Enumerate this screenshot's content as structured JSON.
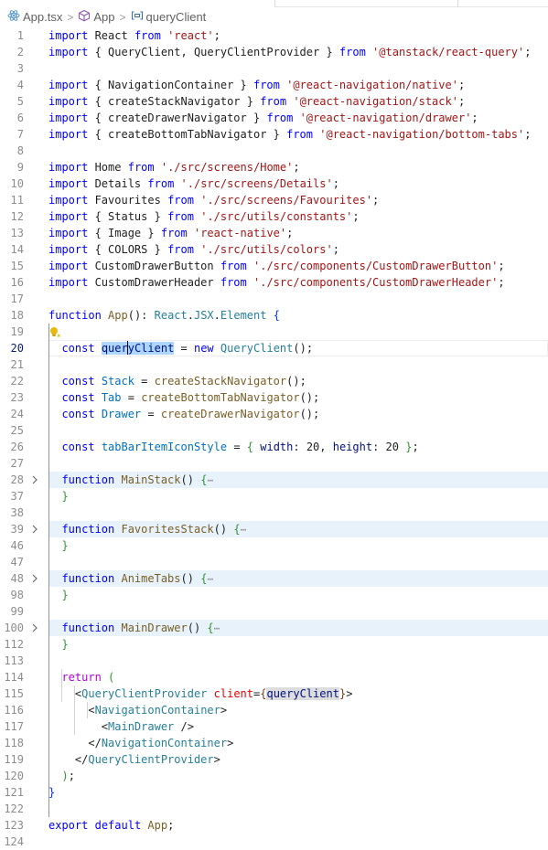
{
  "breadcrumb": {
    "file": "App.tsx",
    "symbol1": "App",
    "symbol2": "queryClient"
  },
  "lines": [
    {
      "n": "1",
      "tokens": [
        [
          "kw",
          "import"
        ],
        [
          "p",
          " React "
        ],
        [
          "kw",
          "from"
        ],
        [
          "p",
          " "
        ],
        [
          "str",
          "'react'"
        ],
        [
          "p",
          ";"
        ]
      ]
    },
    {
      "n": "2",
      "tokens": [
        [
          "kw",
          "import"
        ],
        [
          "p",
          " { QueryClient, QueryClientProvider } "
        ],
        [
          "kw",
          "from"
        ],
        [
          "p",
          " "
        ],
        [
          "str",
          "'@tanstack/react-query'"
        ],
        [
          "p",
          ";"
        ]
      ]
    },
    {
      "n": "3",
      "tokens": []
    },
    {
      "n": "4",
      "tokens": [
        [
          "kw",
          "import"
        ],
        [
          "p",
          " { NavigationContainer } "
        ],
        [
          "kw",
          "from"
        ],
        [
          "p",
          " "
        ],
        [
          "str",
          "'@react-navigation/native'"
        ],
        [
          "p",
          ";"
        ]
      ]
    },
    {
      "n": "5",
      "tokens": [
        [
          "kw",
          "import"
        ],
        [
          "p",
          " { createStackNavigator } "
        ],
        [
          "kw",
          "from"
        ],
        [
          "p",
          " "
        ],
        [
          "str",
          "'@react-navigation/stack'"
        ],
        [
          "p",
          ";"
        ]
      ]
    },
    {
      "n": "6",
      "tokens": [
        [
          "kw",
          "import"
        ],
        [
          "p",
          " { createDrawerNavigator } "
        ],
        [
          "kw",
          "from"
        ],
        [
          "p",
          " "
        ],
        [
          "str",
          "'@react-navigation/drawer'"
        ],
        [
          "p",
          ";"
        ]
      ]
    },
    {
      "n": "7",
      "tokens": [
        [
          "kw",
          "import"
        ],
        [
          "p",
          " { createBottomTabNavigator } "
        ],
        [
          "kw",
          "from"
        ],
        [
          "p",
          " "
        ],
        [
          "str",
          "'@react-navigation/bottom-tabs'"
        ],
        [
          "p",
          ";"
        ]
      ]
    },
    {
      "n": "8",
      "tokens": []
    },
    {
      "n": "9",
      "tokens": [
        [
          "kw",
          "import"
        ],
        [
          "p",
          " Home "
        ],
        [
          "kw",
          "from"
        ],
        [
          "p",
          " "
        ],
        [
          "str",
          "'./src/screens/Home'"
        ],
        [
          "p",
          ";"
        ]
      ]
    },
    {
      "n": "10",
      "tokens": [
        [
          "kw",
          "import"
        ],
        [
          "p",
          " Details "
        ],
        [
          "kw",
          "from"
        ],
        [
          "p",
          " "
        ],
        [
          "str",
          "'./src/screens/Details'"
        ],
        [
          "p",
          ";"
        ]
      ]
    },
    {
      "n": "11",
      "tokens": [
        [
          "kw",
          "import"
        ],
        [
          "p",
          " Favourites "
        ],
        [
          "kw",
          "from"
        ],
        [
          "p",
          " "
        ],
        [
          "str",
          "'./src/screens/Favourites'"
        ],
        [
          "p",
          ";"
        ]
      ]
    },
    {
      "n": "12",
      "tokens": [
        [
          "kw",
          "import"
        ],
        [
          "p",
          " { Status } "
        ],
        [
          "kw",
          "from"
        ],
        [
          "p",
          " "
        ],
        [
          "str",
          "'./src/utils/constants'"
        ],
        [
          "p",
          ";"
        ]
      ]
    },
    {
      "n": "13",
      "tokens": [
        [
          "kw",
          "import"
        ],
        [
          "p",
          " { Image } "
        ],
        [
          "kw",
          "from"
        ],
        [
          "p",
          " "
        ],
        [
          "str",
          "'react-native'"
        ],
        [
          "p",
          ";"
        ]
      ]
    },
    {
      "n": "14",
      "tokens": [
        [
          "kw",
          "import"
        ],
        [
          "p",
          " { COLORS } "
        ],
        [
          "kw",
          "from"
        ],
        [
          "p",
          " "
        ],
        [
          "str",
          "'./src/utils/colors'"
        ],
        [
          "p",
          ";"
        ]
      ]
    },
    {
      "n": "15",
      "tokens": [
        [
          "kw",
          "import"
        ],
        [
          "p",
          " CustomDrawerButton "
        ],
        [
          "kw",
          "from"
        ],
        [
          "p",
          " "
        ],
        [
          "str",
          "'./src/components/CustomDrawerButton'"
        ],
        [
          "p",
          ";"
        ]
      ]
    },
    {
      "n": "16",
      "tokens": [
        [
          "kw",
          "import"
        ],
        [
          "p",
          " CustomDrawerHeader "
        ],
        [
          "kw",
          "from"
        ],
        [
          "p",
          " "
        ],
        [
          "str",
          "'./src/components/CustomDrawerHeader'"
        ],
        [
          "p",
          ";"
        ]
      ]
    },
    {
      "n": "17",
      "tokens": []
    },
    {
      "n": "18",
      "tokens": [
        [
          "kw",
          "function"
        ],
        [
          "p",
          " "
        ],
        [
          "fn",
          "App"
        ],
        [
          "p",
          "(): "
        ],
        [
          "type",
          "React"
        ],
        [
          "p",
          "."
        ],
        [
          "type",
          "JSX"
        ],
        [
          "p",
          "."
        ],
        [
          "type",
          "Element"
        ],
        [
          "p",
          " "
        ],
        [
          "brace1",
          "{"
        ]
      ]
    },
    {
      "n": "19",
      "tokens": []
    },
    {
      "n": "20",
      "tokens": [
        [
          "p",
          "  "
        ],
        [
          "kw",
          "const"
        ],
        [
          "p",
          " "
        ],
        [
          "selA",
          "quer"
        ],
        [
          "caret",
          ""
        ],
        [
          "selB",
          "yClient"
        ],
        [
          "p",
          " = "
        ],
        [
          "kw",
          "new"
        ],
        [
          "p",
          " "
        ],
        [
          "type",
          "QueryClient"
        ],
        [
          "p",
          "();"
        ]
      ]
    },
    {
      "n": "21",
      "tokens": []
    },
    {
      "n": "22",
      "tokens": [
        [
          "p",
          "  "
        ],
        [
          "kw",
          "const"
        ],
        [
          "p",
          " "
        ],
        [
          "const",
          "Stack"
        ],
        [
          "p",
          " = "
        ],
        [
          "fn",
          "createStackNavigator"
        ],
        [
          "p",
          "();"
        ]
      ]
    },
    {
      "n": "23",
      "tokens": [
        [
          "p",
          "  "
        ],
        [
          "kw",
          "const"
        ],
        [
          "p",
          " "
        ],
        [
          "const",
          "Tab"
        ],
        [
          "p",
          " = "
        ],
        [
          "fn",
          "createBottomTabNavigator"
        ],
        [
          "p",
          "();"
        ]
      ]
    },
    {
      "n": "24",
      "tokens": [
        [
          "p",
          "  "
        ],
        [
          "kw",
          "const"
        ],
        [
          "p",
          " "
        ],
        [
          "const",
          "Drawer"
        ],
        [
          "p",
          " = "
        ],
        [
          "fn",
          "createDrawerNavigator"
        ],
        [
          "p",
          "();"
        ]
      ]
    },
    {
      "n": "25",
      "tokens": []
    },
    {
      "n": "26",
      "tokens": [
        [
          "p",
          "  "
        ],
        [
          "kw",
          "const"
        ],
        [
          "p",
          " "
        ],
        [
          "const",
          "tabBarItemIconStyle"
        ],
        [
          "p",
          " = "
        ],
        [
          "brace2",
          "{"
        ],
        [
          "p",
          " "
        ],
        [
          "var",
          "width"
        ],
        [
          "p",
          ": "
        ],
        [
          "num",
          "20"
        ],
        [
          "p",
          ", "
        ],
        [
          "var",
          "height"
        ],
        [
          "p",
          ": "
        ],
        [
          "num",
          "20"
        ],
        [
          "p",
          " "
        ],
        [
          "brace2",
          "}"
        ],
        [
          "p",
          ";"
        ]
      ]
    },
    {
      "n": "27",
      "tokens": []
    },
    {
      "n": "28",
      "fold": true,
      "tokens": [
        [
          "p",
          "  "
        ],
        [
          "kw",
          "function"
        ],
        [
          "p",
          " "
        ],
        [
          "fn",
          "MainStack"
        ],
        [
          "p",
          "() "
        ],
        [
          "brace2",
          "{"
        ],
        [
          "ell",
          "⋯"
        ]
      ]
    },
    {
      "n": "37",
      "tokens": [
        [
          "p",
          "  "
        ],
        [
          "brace2",
          "}"
        ]
      ]
    },
    {
      "n": "38",
      "tokens": []
    },
    {
      "n": "39",
      "fold": true,
      "tokens": [
        [
          "p",
          "  "
        ],
        [
          "kw",
          "function"
        ],
        [
          "p",
          " "
        ],
        [
          "fn",
          "FavoritesStack"
        ],
        [
          "p",
          "() "
        ],
        [
          "brace2",
          "{"
        ],
        [
          "ell",
          "⋯"
        ]
      ]
    },
    {
      "n": "46",
      "tokens": [
        [
          "p",
          "  "
        ],
        [
          "brace2",
          "}"
        ]
      ]
    },
    {
      "n": "47",
      "tokens": []
    },
    {
      "n": "48",
      "fold": true,
      "tokens": [
        [
          "p",
          "  "
        ],
        [
          "kw",
          "function"
        ],
        [
          "p",
          " "
        ],
        [
          "fn",
          "AnimeTabs"
        ],
        [
          "p",
          "() "
        ],
        [
          "brace2",
          "{"
        ],
        [
          "ell",
          "⋯"
        ]
      ]
    },
    {
      "n": "98",
      "tokens": [
        [
          "p",
          "  "
        ],
        [
          "brace2",
          "}"
        ]
      ]
    },
    {
      "n": "99",
      "tokens": []
    },
    {
      "n": "100",
      "fold": true,
      "tokens": [
        [
          "p",
          "  "
        ],
        [
          "kw",
          "function"
        ],
        [
          "p",
          " "
        ],
        [
          "fn",
          "MainDrawer"
        ],
        [
          "p",
          "() "
        ],
        [
          "brace2",
          "{"
        ],
        [
          "ell",
          "⋯"
        ]
      ]
    },
    {
      "n": "112",
      "tokens": [
        [
          "p",
          "  "
        ],
        [
          "brace2",
          "}"
        ]
      ]
    },
    {
      "n": "113",
      "tokens": []
    },
    {
      "n": "114",
      "tokens": [
        [
          "p",
          "  "
        ],
        [
          "ctl",
          "return"
        ],
        [
          "p",
          " "
        ],
        [
          "brace2",
          "("
        ]
      ]
    },
    {
      "n": "115",
      "tokens": [
        [
          "p",
          "    "
        ],
        [
          "p",
          "<"
        ],
        [
          "type",
          "QueryClientProvider"
        ],
        [
          "p",
          " "
        ],
        [
          "attr",
          "client"
        ],
        [
          "p",
          "="
        ],
        [
          "brace3",
          "{"
        ],
        [
          "sel2",
          "queryClient"
        ],
        [
          "brace3",
          "}"
        ],
        [
          "p",
          ">"
        ]
      ]
    },
    {
      "n": "116",
      "tokens": [
        [
          "p",
          "      "
        ],
        [
          "p",
          "<"
        ],
        [
          "type",
          "NavigationContainer"
        ],
        [
          "p",
          ">"
        ]
      ]
    },
    {
      "n": "117",
      "tokens": [
        [
          "p",
          "        "
        ],
        [
          "p",
          "<"
        ],
        [
          "type",
          "MainDrawer"
        ],
        [
          "p",
          " />"
        ]
      ]
    },
    {
      "n": "118",
      "tokens": [
        [
          "p",
          "      "
        ],
        [
          "p",
          "</"
        ],
        [
          "type",
          "NavigationContainer"
        ],
        [
          "p",
          ">"
        ]
      ]
    },
    {
      "n": "119",
      "tokens": [
        [
          "p",
          "    "
        ],
        [
          "p",
          "</"
        ],
        [
          "type",
          "QueryClientProvider"
        ],
        [
          "p",
          ">"
        ]
      ]
    },
    {
      "n": "120",
      "tokens": [
        [
          "p",
          "  "
        ],
        [
          "brace2",
          ")"
        ],
        [
          "p",
          ";"
        ]
      ]
    },
    {
      "n": "121",
      "tokens": [
        [
          "brace1",
          "}"
        ]
      ]
    },
    {
      "n": "122",
      "tokens": []
    },
    {
      "n": "123",
      "tokens": [
        [
          "kw",
          "export"
        ],
        [
          "p",
          " "
        ],
        [
          "kw",
          "default"
        ],
        [
          "p",
          " "
        ],
        [
          "fn",
          "App"
        ],
        [
          "p",
          ";"
        ]
      ]
    },
    {
      "n": "124",
      "tokens": []
    }
  ],
  "colors": {
    "keyword": "#0000ff",
    "string": "#a31515",
    "type": "#267f99",
    "function": "#795e26",
    "selection": "#add6ff",
    "folded_line_bg": "#e8f2fb"
  },
  "icons": {
    "file_icon": "react-tsx-icon",
    "symbol1_icon": "cube-icon",
    "symbol2_icon": "variable-icon",
    "lightbulb": "lightbulb-icon",
    "fold": "chevron-right-icon"
  },
  "cursor_line": "20"
}
